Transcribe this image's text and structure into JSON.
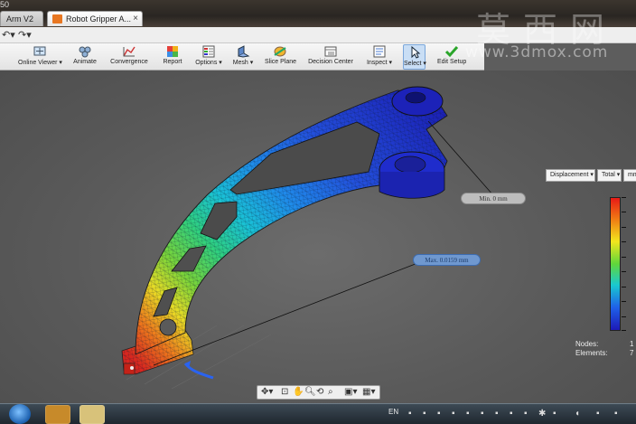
{
  "window": {
    "title_fragment": "50"
  },
  "tabs": [
    {
      "label": "Arm V2"
    },
    {
      "label": "Robot Gripper A..."
    }
  ],
  "quick_access": {
    "undo_icon": "undo-icon",
    "redo_icon": "redo-icon"
  },
  "ribbon": {
    "items": [
      {
        "label": "Online Viewer",
        "dropdown": true,
        "icon": "viewer-icon"
      },
      {
        "label": "Animate",
        "dropdown": false,
        "icon": "animate-icon"
      },
      {
        "label": "Convergence",
        "dropdown": false,
        "icon": "convergence-icon"
      },
      {
        "label": "Report",
        "dropdown": false,
        "icon": "report-icon"
      },
      {
        "label": "Options",
        "dropdown": true,
        "icon": "options-icon"
      },
      {
        "label": "Mesh",
        "dropdown": true,
        "icon": "mesh-icon"
      },
      {
        "label": "Slice Plane",
        "dropdown": false,
        "icon": "slice-plane-icon"
      },
      {
        "label": "Decision Center",
        "dropdown": false,
        "icon": "decision-center-icon"
      },
      {
        "label": "Inspect",
        "dropdown": true,
        "icon": "inspect-icon"
      },
      {
        "label": "Select",
        "dropdown": true,
        "icon": "select-icon",
        "selected": true
      },
      {
        "label": "Edit Setup",
        "dropdown": false,
        "icon": "edit-setup-icon"
      }
    ]
  },
  "result_controls": {
    "result_type": "Displacement",
    "component": "Total",
    "unit": "mm"
  },
  "probes": {
    "min_label": "Min. 0 mm",
    "max_label": "Max. 0.0159 mm"
  },
  "legend": {
    "colors": [
      "#e81a16",
      "#f07a14",
      "#f2e61d",
      "#5fd73b",
      "#19c9d0",
      "#1f60e8",
      "#1d1ab8"
    ]
  },
  "mesh_stats": {
    "nodes_label": "Nodes:",
    "nodes_value": "1",
    "elements_label": "Elements:",
    "elements_value": "7"
  },
  "taskbar": {
    "language": "EN"
  },
  "watermark": {
    "logo_text": "莫西网",
    "url": "www.3dmox.com"
  }
}
